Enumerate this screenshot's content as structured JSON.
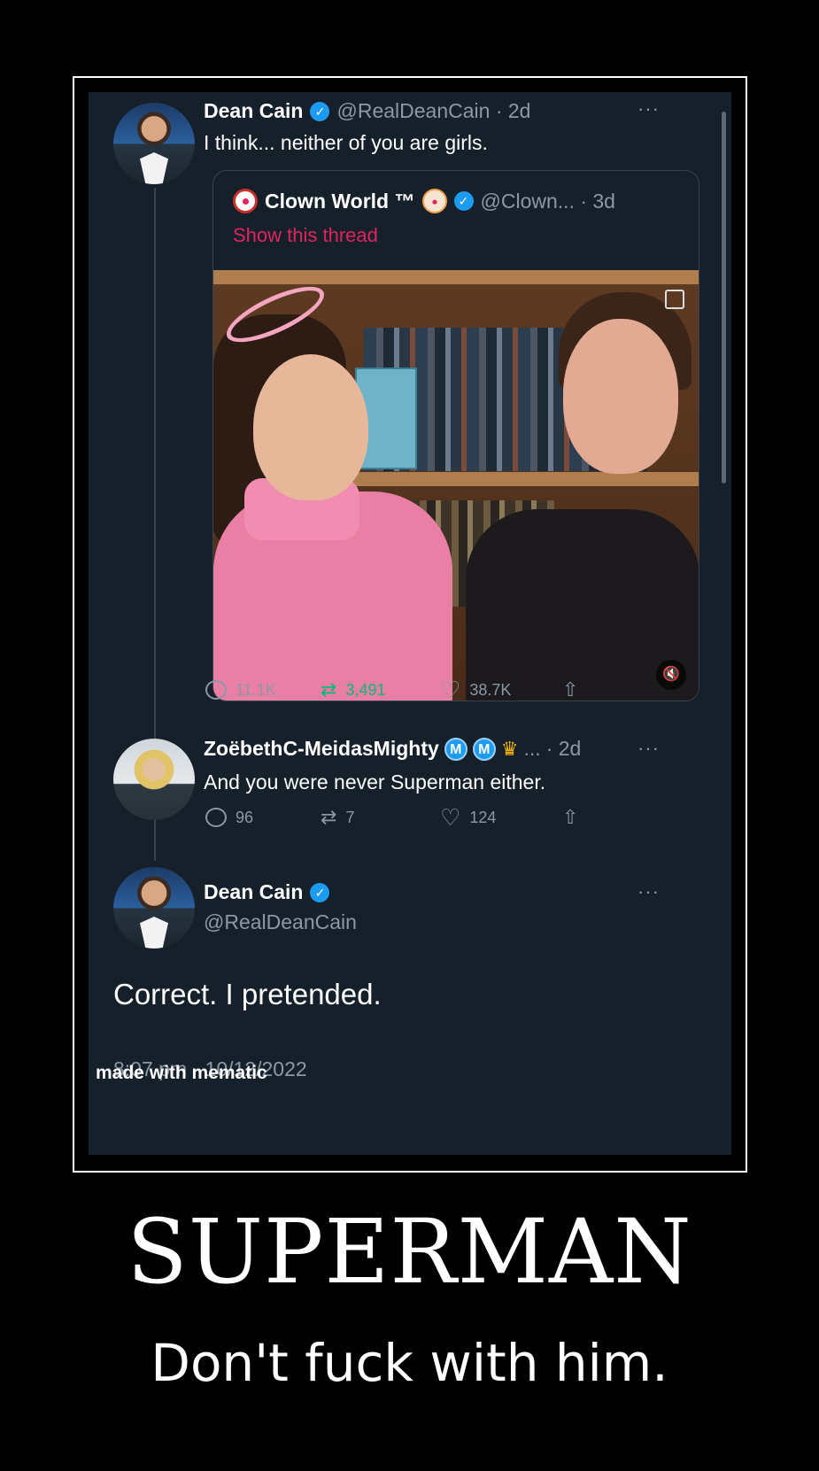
{
  "tweet1": {
    "name": "Dean Cain",
    "handle_time": "@RealDeanCain · 2d",
    "text": "I think... neither of you are girls.",
    "more": "···"
  },
  "quote": {
    "name": "Clown World ™",
    "handle_time": "@Clown... · 3d",
    "show_thread": "Show this thread"
  },
  "tweet1_stats": {
    "replies": "11.1K",
    "retweets": "3,491",
    "likes": "38.7K"
  },
  "tweet2": {
    "name": "ZoëbethC-MeidasMighty",
    "badge_1": "M",
    "badge_2": "M",
    "ellipsis": "...",
    "time": "· 2d",
    "text": "And you were never Superman either.",
    "more": "···",
    "replies": "96",
    "retweets": "7",
    "likes": "124"
  },
  "tweet3": {
    "name": "Dean Cain",
    "handle": "@RealDeanCain",
    "text": "Correct. I pretended.",
    "timestamp": "8:07 pm · 10/12/2022",
    "more": "···"
  },
  "watermark": "made with mematic",
  "poster": {
    "title": "SUPERMAN",
    "subtitle": "Don't fuck with him."
  },
  "colors": {
    "background": "#15202b",
    "link_pink": "#e0245e",
    "retweet_green": "#00ba7c",
    "verified_blue": "#1d9bf0"
  },
  "icons": [
    "verified-icon",
    "reply-icon",
    "retweet-icon",
    "like-icon",
    "share-icon",
    "mute-icon",
    "clown-icon"
  ]
}
